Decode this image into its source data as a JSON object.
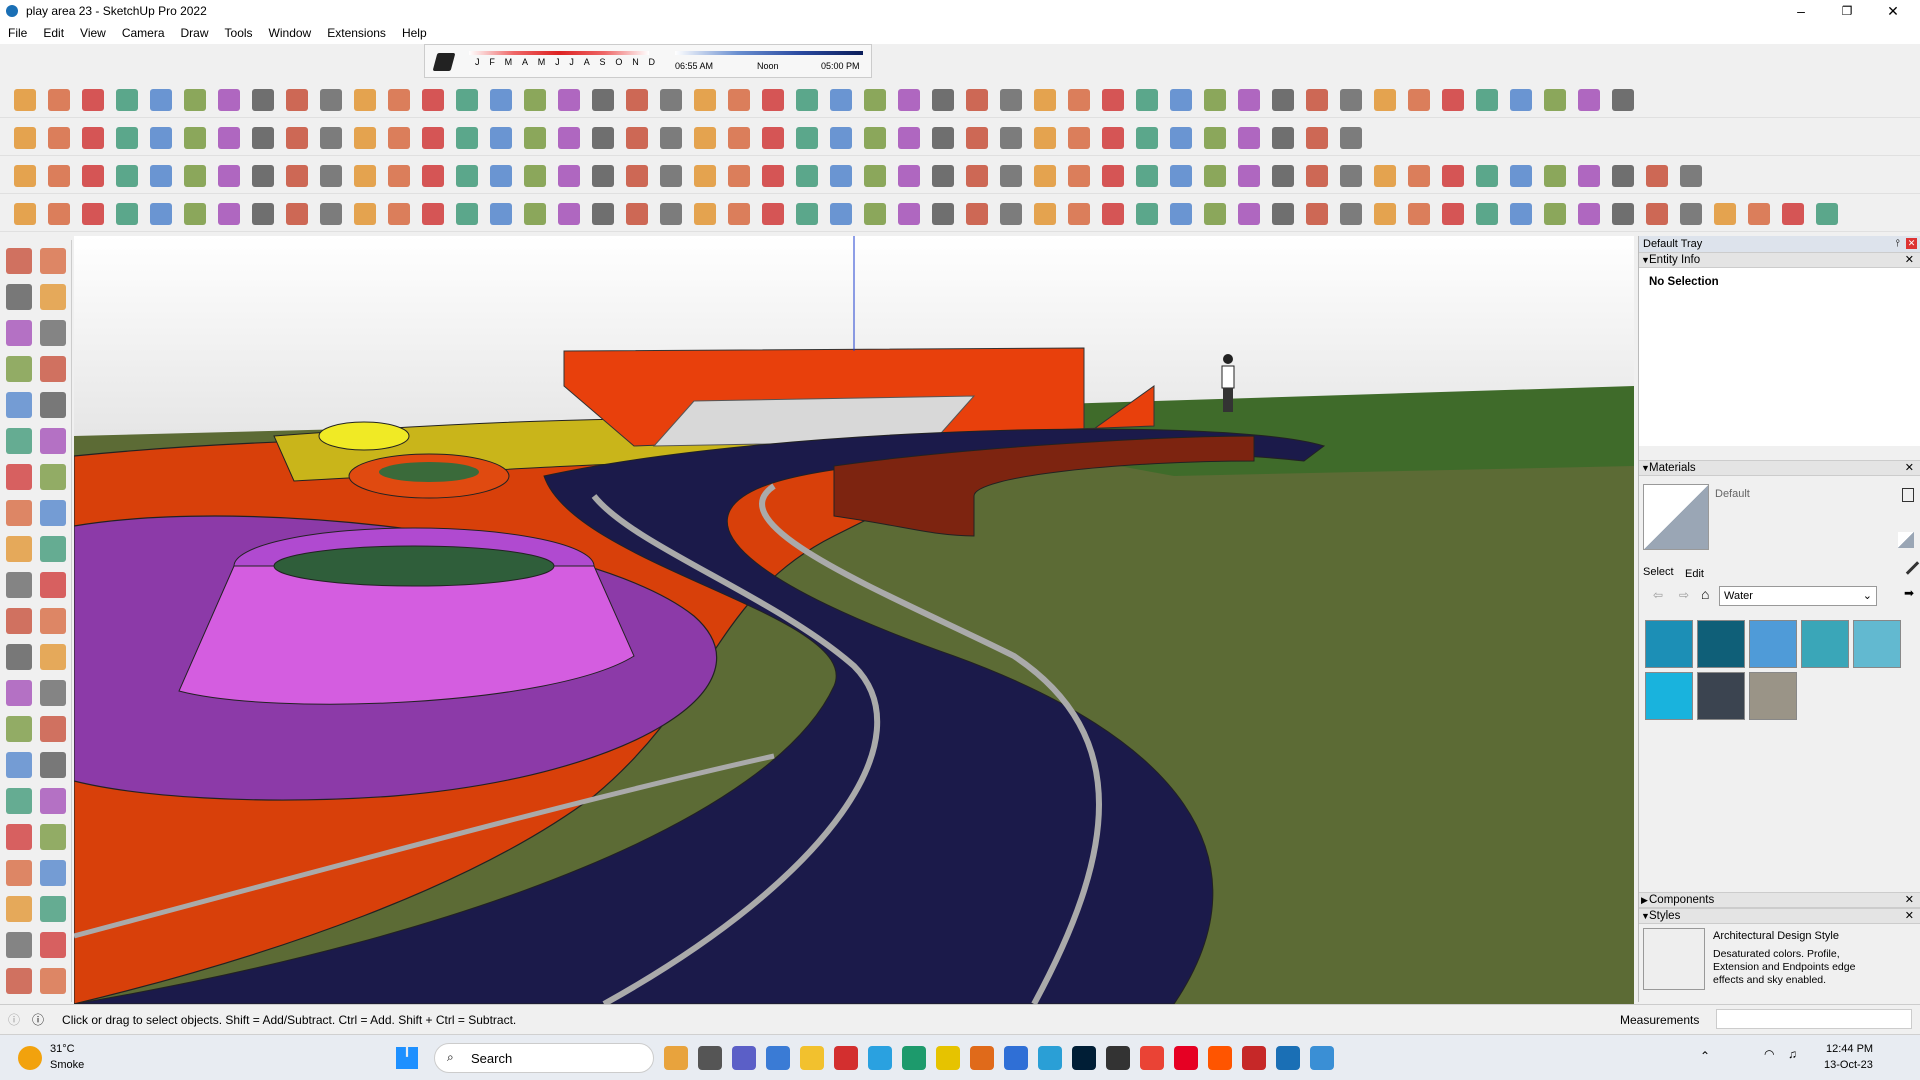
{
  "window": {
    "title": "play area 23 - SketchUp Pro 2022"
  },
  "menu": [
    "File",
    "Edit",
    "View",
    "Camera",
    "Draw",
    "Tools",
    "Window",
    "Extensions",
    "Help"
  ],
  "shadow": {
    "months": [
      "J",
      "F",
      "M",
      "A",
      "M",
      "J",
      "J",
      "A",
      "S",
      "O",
      "N",
      "D"
    ],
    "time_start": "06:55 AM",
    "time_mid": "Noon",
    "time_end": "05:00 PM"
  },
  "tray": {
    "title": "Default Tray",
    "entity_info": {
      "header": "Entity Info",
      "selection": "No Selection"
    },
    "materials": {
      "header": "Materials",
      "current": "Default",
      "tab_select": "Select",
      "tab_edit": "Edit",
      "library": "Water",
      "swatch_colors": [
        "#1c8fb6",
        "#0f5f78",
        "#4f9bd8",
        "#3aa6b8",
        "#62b9d0",
        "#19b3dd",
        "#3b4450",
        "#9a9487"
      ]
    },
    "components": {
      "header": "Components"
    },
    "styles": {
      "header": "Styles",
      "name": "Architectural Design Style",
      "description": "Desaturated colors. Profile, Extension and Endpoints edge effects and sky enabled."
    }
  },
  "status": {
    "hint": "Click or drag to select objects. Shift = Add/Subtract. Ctrl = Add. Shift + Ctrl = Subtract.",
    "measurements_label": "Measurements"
  },
  "taskbar": {
    "weather_temp": "31°C",
    "weather_desc": "Smoke",
    "search_placeholder": "Search",
    "time": "12:44 PM",
    "date": "13-Oct-23"
  }
}
